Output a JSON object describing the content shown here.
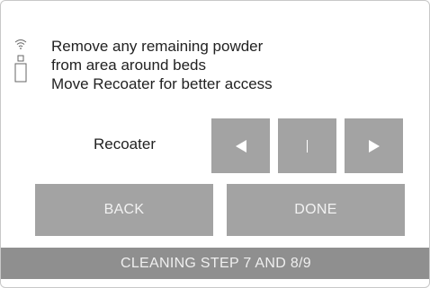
{
  "status_icons": {
    "wifi": "wifi-icon",
    "usb": "usb-icon"
  },
  "instructions": {
    "line1": "Remove any remaining powder",
    "line2": "from area around beds",
    "line3": "Move Recoater for better access"
  },
  "jog": {
    "label": "Recoater",
    "left_icon": "arrow-left-icon",
    "stop_icon": "stop-bar-icon",
    "right_icon": "arrow-right-icon"
  },
  "actions": {
    "back_label": "BACK",
    "done_label": "DONE"
  },
  "footer": {
    "step_text": "CLEANING STEP 7 AND 8/9"
  },
  "colors": {
    "button_gray": "#a3a3a3",
    "footer_gray": "#8f8f8f"
  }
}
